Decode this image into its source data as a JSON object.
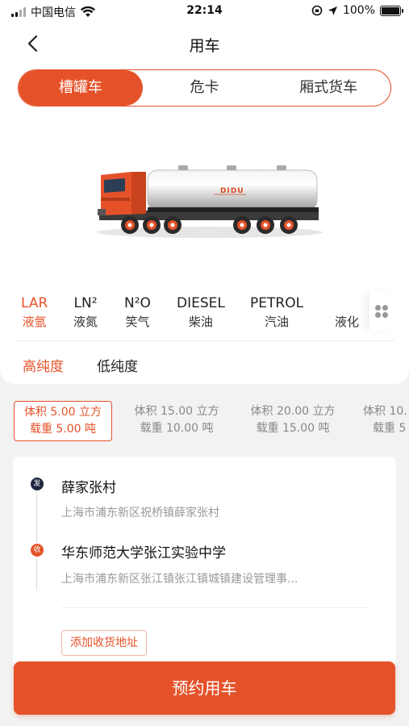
{
  "status_bar": {
    "carrier": "中国电信",
    "time": "22:14",
    "battery": "100%"
  },
  "nav": {
    "title": "用车"
  },
  "segments": [
    {
      "label": "槽罐车",
      "active": true
    },
    {
      "label": "危卡",
      "active": false
    },
    {
      "label": "厢式货车",
      "active": false
    }
  ],
  "truck": {
    "brand_text": "DIDU"
  },
  "cargo_types": [
    {
      "en": "LAR",
      "cn": "液氩",
      "active": true
    },
    {
      "en": "LN²",
      "cn": "液氮",
      "active": false
    },
    {
      "en": "N²O",
      "cn": "笑气",
      "active": false
    },
    {
      "en": "DIESEL",
      "cn": "柴油",
      "active": false
    },
    {
      "en": "PETROL",
      "cn": "汽油",
      "active": false
    },
    {
      "en": "",
      "cn": "液化",
      "active": false
    }
  ],
  "purity": [
    {
      "label": "高纯度",
      "active": true
    },
    {
      "label": "低纯度",
      "active": false
    }
  ],
  "specs": [
    {
      "volume": "体积 5.00 立方",
      "load": "载重 5.00 吨",
      "active": true
    },
    {
      "volume": "体积 15.00 立方",
      "load": "载重 10.00 吨",
      "active": false
    },
    {
      "volume": "体积 20.00 立方",
      "load": "载重 15.00 吨",
      "active": false
    },
    {
      "volume": "体积 10.",
      "load": "载重 5",
      "active": false
    }
  ],
  "route": {
    "send_badge": "发",
    "recv_badge": "收",
    "origin_name": "薛家张村",
    "origin_detail": "上海市浦东新区祝桥镇薛家张村",
    "dest_name": "华东师范大学张江实验中学",
    "dest_detail": "上海市浦东新区张江镇张江镇城镇建设管理事...",
    "add_label": "添加收货地址"
  },
  "book_label": "预约用车",
  "colors": {
    "accent": "#e5522a",
    "send_dot": "#1f2640"
  }
}
